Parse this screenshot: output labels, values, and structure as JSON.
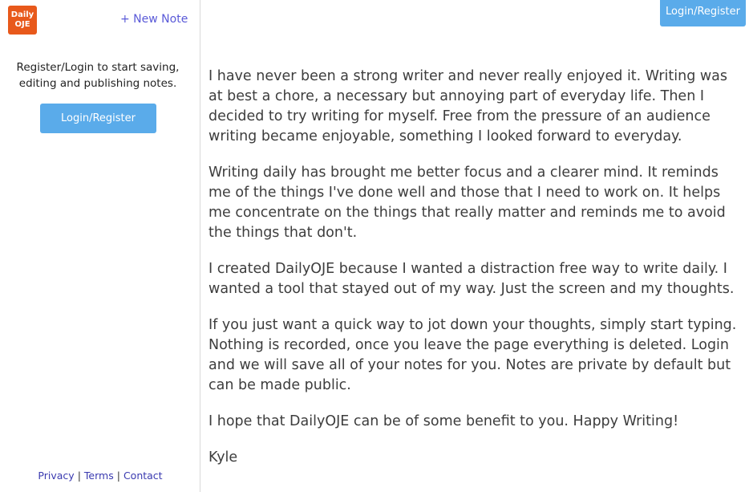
{
  "logo": {
    "line1": "Daily",
    "line2": "OJE",
    "color": "#e8591b"
  },
  "sidebar": {
    "new_note_label": "+ New Note",
    "message": "Register/Login to start saving, editing and publishing notes.",
    "login_button_label": "Login/Register"
  },
  "footer": {
    "privacy": "Privacy",
    "terms": "Terms",
    "contact": "Contact",
    "separator": "|"
  },
  "header": {
    "login_button_label": "Login/Register"
  },
  "note": {
    "paragraphs": [
      "I have never been a strong writer and never really enjoyed it. Writing was at best a chore, a necessary but annoying part of everyday life. Then I decided to try writing for myself. Free from the pressure of an audience writing became enjoyable, something I looked forward to everyday.",
      "Writing daily has brought me better focus and a clearer mind. It reminds me of the things I've done well and those that I need to work on. It helps me concentrate on the things that really matter and reminds me to avoid the things that don't.",
      "I created DailyOJE because I wanted a distraction free way to write daily. I wanted a tool that stayed out of my way. Just the screen and my thoughts.",
      "If you just want a quick way to jot down your thoughts, simply start typing. Nothing is recorded, once you leave the page everything is deleted. Login and we will save all of your notes for you. Notes are private by default but can be made public.",
      "I hope that DailyOJE can be of some benefit to you. Happy Writing!",
      "Kyle"
    ]
  },
  "colors": {
    "accent_button": "#5aabea",
    "link": "#5a5ad8"
  }
}
